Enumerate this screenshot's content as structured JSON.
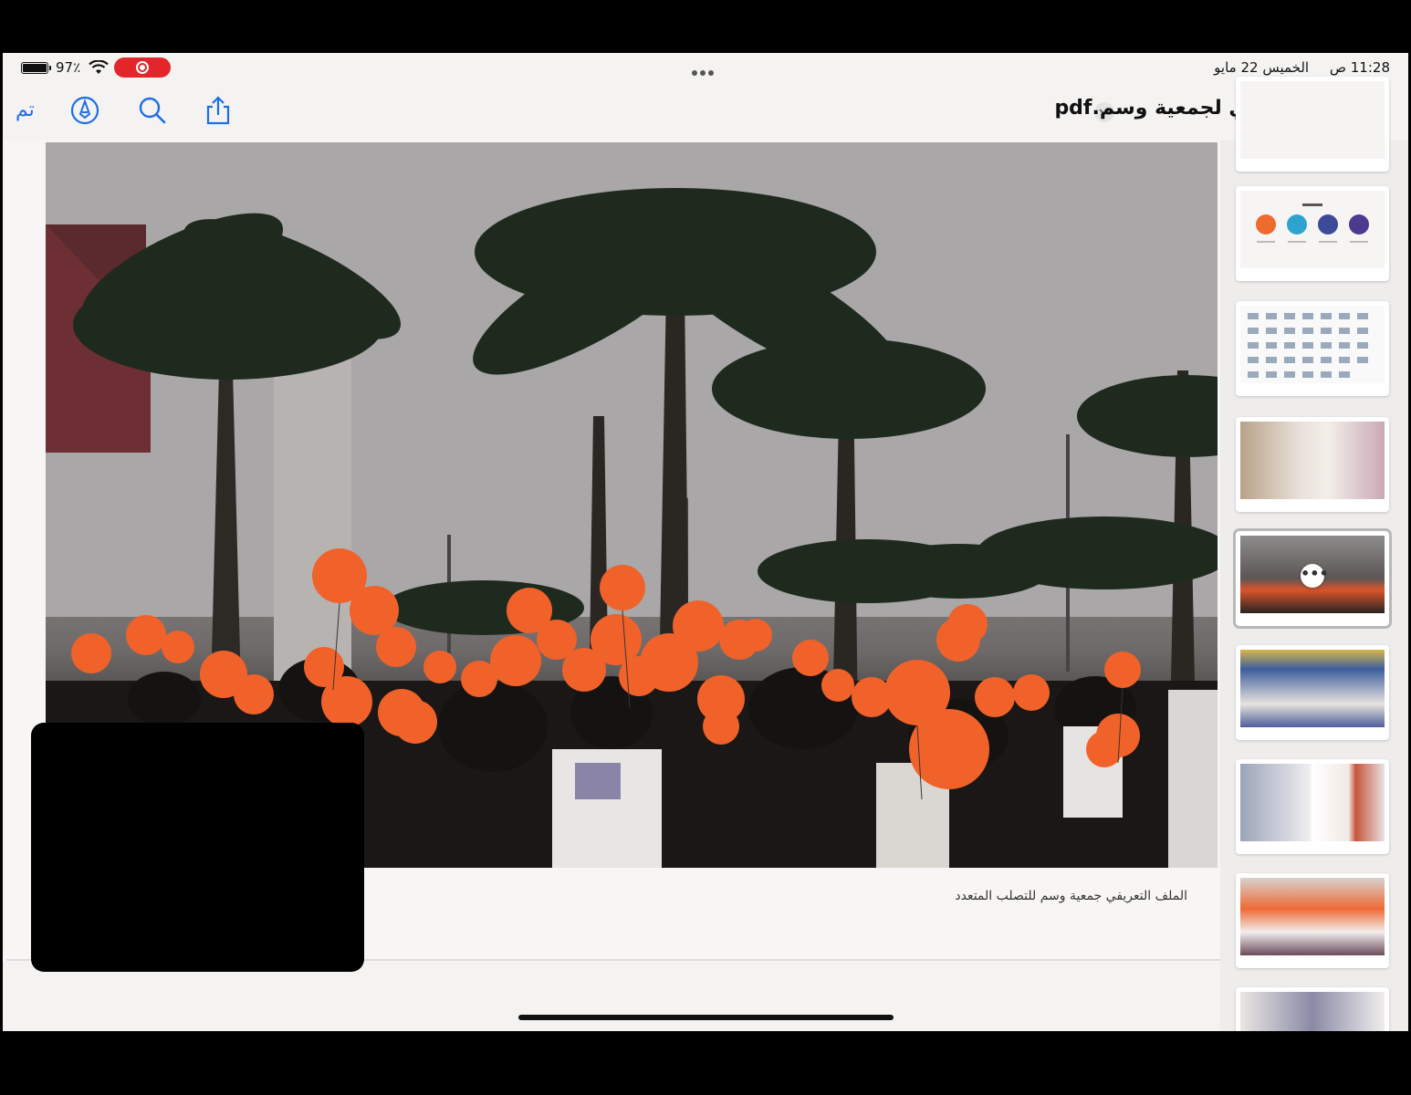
{
  "status_bar": {
    "battery_pct": "97٪",
    "time": "11:28 ص",
    "date": "الخميس 22 مايو"
  },
  "toolbar": {
    "done_label": "تم",
    "document_title": "الملف التعريفي لجمعية وسم.pdf"
  },
  "page": {
    "caption": "الملف التعريفي جمعية وسم للتصلب المتعدد"
  },
  "colors": {
    "accent": "#1d6ee6",
    "record": "#e3262b",
    "balloon": "#f0622a"
  },
  "icons": [
    "markup-pen-icon",
    "search-icon",
    "share-icon",
    "wifi-icon",
    "battery-icon",
    "chevron-down-icon"
  ]
}
